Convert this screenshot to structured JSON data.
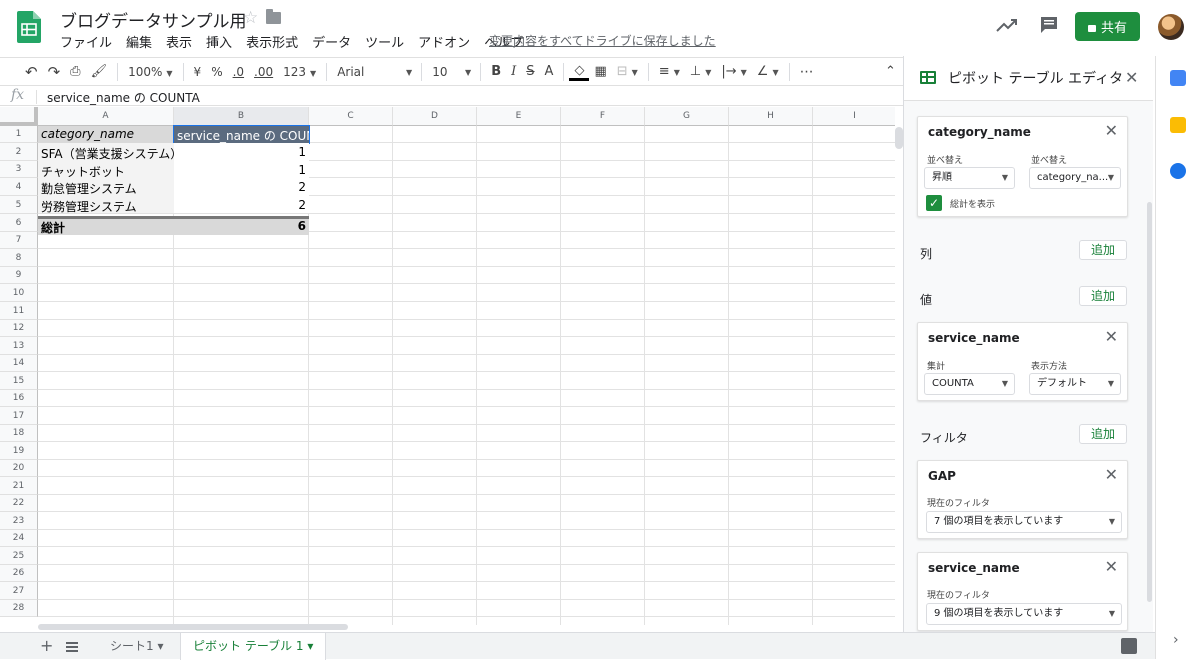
{
  "header": {
    "doc_title": "ブログデータサンプル用",
    "menus": [
      "ファイル",
      "編集",
      "表示",
      "挿入",
      "表示形式",
      "データ",
      "ツール",
      "アドオン",
      "ヘルプ"
    ],
    "save_status": "変更内容をすべてドライブに保存しました",
    "share_label": "共有"
  },
  "toolbar": {
    "zoom": "100%",
    "currency": "¥",
    "percent": "%",
    "decimal_less": ".0",
    "decimal_more": ".00",
    "format": "123",
    "font": "Arial",
    "font_size": "10",
    "bold": "B",
    "italic": "I",
    "strike": "S",
    "text_color": "A",
    "more": "⋯"
  },
  "formula_bar": {
    "fx": "fx",
    "content": "service_name の COUNTA"
  },
  "grid": {
    "columns": [
      "A",
      "B",
      "C",
      "D",
      "E",
      "F",
      "G",
      "H",
      "I"
    ],
    "rows": [
      "1",
      "2",
      "3",
      "4",
      "5",
      "6",
      "7",
      "8",
      "9",
      "10",
      "11",
      "12",
      "13",
      "14",
      "15",
      "16",
      "17",
      "18",
      "19",
      "20",
      "21",
      "22",
      "23",
      "24",
      "25",
      "26",
      "27",
      "28"
    ],
    "cells": {
      "a1": "category_name",
      "b1": "service_name の COUNTA",
      "a2": "SFA（営業支援システム）",
      "b2": "1",
      "a3": "チャットボット",
      "b3": "1",
      "a4": "勤怠管理システム",
      "b4": "2",
      "a5": "労務管理システム",
      "b5": "2",
      "a6": "総計",
      "b6": "6"
    }
  },
  "sheets": {
    "tabs": [
      {
        "label": "シート1 ▾"
      },
      {
        "label": "ピボット テーブル 1 ▾"
      }
    ]
  },
  "panel": {
    "title": "ピボット テーブル エディタ",
    "rows_card": {
      "title": "category_name",
      "sort_label": "並べ替え",
      "sort_value": "昇順",
      "sortby_label": "並べ替え",
      "sortby_value": "category_na...",
      "show_totals": "総計を表示"
    },
    "columns_label": "列",
    "values_label": "値",
    "add_label": "追加",
    "values_card": {
      "title": "service_name",
      "summarize_label": "集計",
      "summarize_value": "COUNTA",
      "show_as_label": "表示方法",
      "show_as_value": "デフォルト"
    },
    "filters_label": "フィルタ",
    "filter_cards": [
      {
        "title": "GAP",
        "status_label": "現在のフィルタ",
        "status_value": "7 個の項目を表示しています"
      },
      {
        "title": "service_name",
        "status_label": "現在のフィルタ",
        "status_value": "9 個の項目を表示しています"
      }
    ]
  },
  "colors": {
    "accent_green": "#1e8e3e",
    "header_selected": "#5b6b7f",
    "grey_cell": "#d9d9d9"
  }
}
